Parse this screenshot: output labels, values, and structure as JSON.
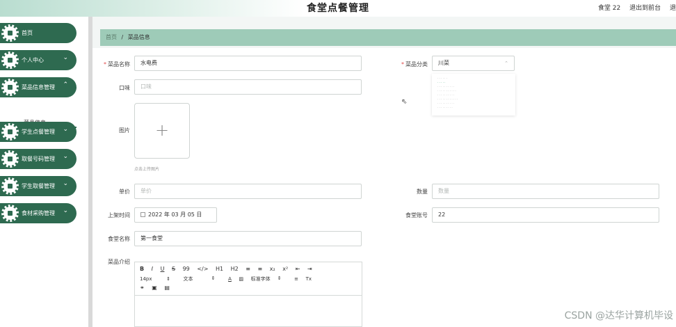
{
  "header": {
    "title": "食堂点餐管理",
    "user": "食堂 22",
    "back_link": "退出到前台",
    "logout_partial": "退"
  },
  "sidebar": {
    "items": [
      {
        "label": "首页",
        "icon": "home-icon"
      },
      {
        "label": "个人中心",
        "icon": "person-icon"
      },
      {
        "label": "菜品信息管理",
        "icon": "grid-icon"
      },
      {
        "label": "学生点餐管理",
        "icon": "document-icon"
      },
      {
        "label": "取餐号码管理",
        "icon": "flag-icon"
      },
      {
        "label": "学生取餐管理",
        "icon": "check-icon"
      },
      {
        "label": "食材采购管理",
        "icon": "send-icon"
      }
    ],
    "submenu_label": "菜品信息"
  },
  "breadcrumb": {
    "home": "首页",
    "separator": "/",
    "current": "菜品信息"
  },
  "form": {
    "dish_name_label": "菜品名称",
    "dish_name_value": "水电费",
    "category_label": "菜品分类",
    "category_value": "川菜",
    "taste_label": "口味",
    "taste_placeholder": "口味",
    "image_label": "图片",
    "upload_hint": "点击上传图片",
    "price_label": "单价",
    "price_placeholder": "单价",
    "quantity_label": "数量",
    "quantity_placeholder": "数量",
    "listing_time_label": "上架时间",
    "listing_time_value": "2022 年 03 月 05 日",
    "canteen_account_label": "食堂账号",
    "canteen_account_value": "22",
    "canteen_name_label": "食堂名称",
    "canteen_name_value": "第一食堂",
    "intro_label": "菜品介绍"
  },
  "editor_toolbar": {
    "row1": [
      "B",
      "I",
      "U",
      "S",
      "99",
      "</>",
      "H1",
      "H2",
      "≡",
      "≡",
      "x₂",
      "x²",
      "⇤",
      "⇥"
    ],
    "font_size": "14px",
    "text_style": "文本",
    "font_family": "标准字体",
    "align_icon": "≡",
    "clear_icon": "Tx"
  },
  "watermark": "CSDN @达华计算机毕设"
}
